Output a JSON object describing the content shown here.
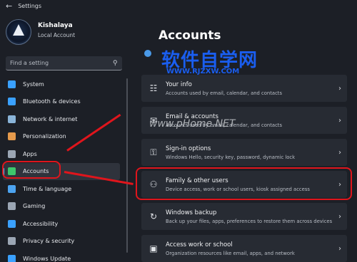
{
  "window": {
    "title": "Settings"
  },
  "profile": {
    "name": "Kishalaya",
    "type": "Local Account"
  },
  "search": {
    "placeholder": "Find a setting"
  },
  "nav": [
    {
      "label": "System",
      "icon": "monitor-icon",
      "color": "#3aa1ff"
    },
    {
      "label": "Bluetooth & devices",
      "icon": "bluetooth-icon",
      "color": "#3aa1ff"
    },
    {
      "label": "Network & internet",
      "icon": "wifi-icon",
      "color": "#8ab4d8"
    },
    {
      "label": "Personalization",
      "icon": "brush-icon",
      "color": "#e59a4c"
    },
    {
      "label": "Apps",
      "icon": "apps-icon",
      "color": "#9ba6b4"
    },
    {
      "label": "Accounts",
      "icon": "person-icon",
      "color": "#3dc66b",
      "active": true
    },
    {
      "label": "Time & language",
      "icon": "globe-clock-icon",
      "color": "#4ca3f0"
    },
    {
      "label": "Gaming",
      "icon": "gamepad-icon",
      "color": "#9ba6b4"
    },
    {
      "label": "Accessibility",
      "icon": "accessibility-icon",
      "color": "#3aa1ff"
    },
    {
      "label": "Privacy & security",
      "icon": "shield-icon",
      "color": "#9ba6b4"
    },
    {
      "label": "Windows Update",
      "icon": "update-icon",
      "color": "#3aa1ff"
    }
  ],
  "main": {
    "heading": "Accounts",
    "cards": [
      {
        "title": "Your info",
        "desc": "Accounts used by email, calendar, and contacts",
        "icon": "id-card-icon"
      },
      {
        "title": "Email & accounts",
        "desc": "Accounts used by email, calendar, and contacts",
        "icon": "mail-icon"
      },
      {
        "title": "Sign-in options",
        "desc": "Windows Hello, security key, password, dynamic lock",
        "icon": "key-icon"
      },
      {
        "title": "Family & other users",
        "desc": "Device access, work or school users, kiosk assigned access",
        "icon": "family-icon"
      },
      {
        "title": "Windows backup",
        "desc": "Back up your files, apps, preferences to restore them across devices",
        "icon": "backup-icon"
      },
      {
        "title": "Access work or school",
        "desc": "Organization resources like email, apps, and network",
        "icon": "briefcase-icon"
      }
    ]
  },
  "watermarks": {
    "top": "软件自学网",
    "sub": "WWW.RJZXW.COM",
    "mid": "www.pHome.NET"
  },
  "colors": {
    "accent": "#4cc2ff",
    "annotation": "#e0151c",
    "watermark": "#1a5ef0"
  }
}
